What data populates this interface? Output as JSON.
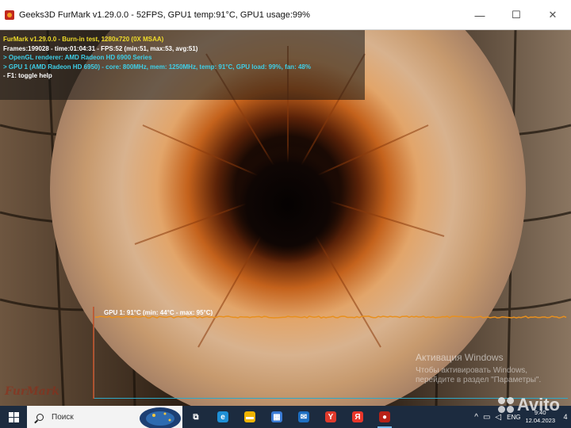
{
  "window": {
    "title": "Geeks3D FurMark v1.29.0.0 - 52FPS, GPU1 temp:91°C, GPU1 usage:99%",
    "minimize_glyph": "—",
    "maximize_glyph": "☐",
    "close_glyph": "✕"
  },
  "hud": {
    "lines": [
      "FurMark v1.29.0.0 - Burn-in test, 1280x720 (0X MSAA)",
      "Frames:199028 - time:01:04:31 - FPS:52 (min:51, max:53, avg:51)",
      "> OpenGL renderer: AMD Radeon HD 6900 Series",
      "> GPU 1 (AMD Radeon HD 6950) - core: 800MHz, mem: 1250MHz, temp: 91°C, GPU load: 99%, fan: 48%",
      "- F1: toggle help"
    ]
  },
  "graph": {
    "label": "GPU 1: 91°C (min: 44°C - max: 95°C)",
    "line_color": "#e8901e",
    "axis_color": "#2fa9c8"
  },
  "watermark": {
    "title": "Активация Windows",
    "line1": "Чтобы активировать Windows,",
    "line2": "перейдите в раздел \"Параметры\"."
  },
  "logo_text": "FurMark",
  "taskbar": {
    "search_placeholder": "Поиск",
    "apps": [
      {
        "name": "task-view",
        "glyph": "⧉",
        "color": "#1c2b3f"
      },
      {
        "name": "edge",
        "glyph": "e",
        "color": "#1f8fd6"
      },
      {
        "name": "file-explorer",
        "glyph": "▬",
        "color": "#f0b400"
      },
      {
        "name": "store",
        "glyph": "▦",
        "color": "#3a7bd5"
      },
      {
        "name": "mail",
        "glyph": "✉",
        "color": "#1e6fc2"
      },
      {
        "name": "yandex-browser",
        "glyph": "Y",
        "color": "#e03a2c"
      },
      {
        "name": "yandex",
        "glyph": "Я",
        "color": "#e8362a"
      },
      {
        "name": "furmark",
        "glyph": "●",
        "color": "#b82218"
      }
    ],
    "tray": {
      "chevron": "^",
      "lang": "ENG",
      "time": "9:40",
      "date": "12.04.2023",
      "notification_count": "4"
    }
  },
  "avito_text": "Avito"
}
